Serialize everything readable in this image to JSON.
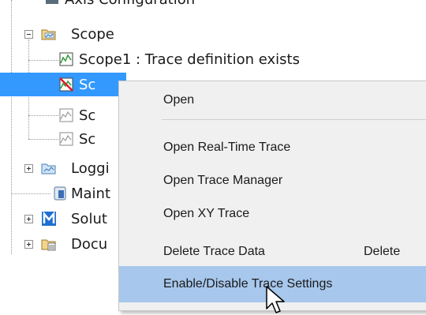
{
  "tree": {
    "items": [
      {
        "label": "Axis Configuration",
        "icon": "axis-config-icon"
      },
      {
        "label": "Scope",
        "icon": "folder-scope-icon",
        "expanded": true
      },
      {
        "label": "Scope1 : Trace definition exists",
        "icon": "trace-defined-icon"
      },
      {
        "label": "Sc",
        "icon": "trace-disabled-icon",
        "selected": true
      },
      {
        "label": "Sc",
        "icon": "trace-icon"
      },
      {
        "label": "Sc",
        "icon": "trace-icon"
      },
      {
        "label": "Loggi",
        "icon": "logging-icon"
      },
      {
        "label": "Maint",
        "icon": "maintenance-icon"
      },
      {
        "label": "Solut",
        "icon": "solution-icon"
      },
      {
        "label": "Docu",
        "icon": "document-icon"
      }
    ]
  },
  "context_menu": {
    "items": [
      {
        "label": "Open",
        "shortcut": ""
      },
      {
        "label": "Open Real-Time Trace",
        "shortcut": ""
      },
      {
        "label": "Open Trace Manager",
        "shortcut": ""
      },
      {
        "label": "Open XY Trace",
        "shortcut": ""
      },
      {
        "label": "Delete Trace Data",
        "shortcut": "Delete"
      },
      {
        "label": "Enable/Disable Trace Settings",
        "shortcut": "",
        "highlighted": true
      }
    ]
  },
  "colors": {
    "selection": "#3399ff",
    "menu_background": "#f0f0f0",
    "menu_highlight": "#a7c7ec"
  }
}
